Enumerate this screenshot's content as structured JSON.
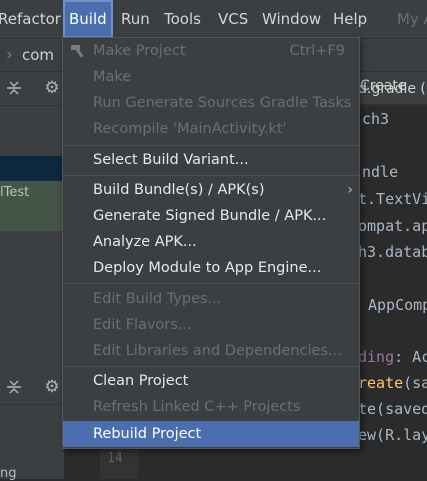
{
  "menubar": {
    "refactor": "Refactor",
    "build": "Build",
    "run": "Run",
    "tools": "Tools",
    "vcs": "VCS",
    "window": "Window",
    "help": "Help",
    "project_title": "My A"
  },
  "breadcrumb": {
    "package": "com"
  },
  "editor_tab": {
    "label": "Create"
  },
  "left_panel": {
    "test_label": "lTest",
    "bottom_text": "ng"
  },
  "code_lines": {
    "l1": "d.gradle (S",
    "l2": "ch3",
    "l3": "ndle",
    "l4": "t.TextVi",
    "l5": "ompat.ap",
    "l6": "h3.datab",
    "l7": "AppComp",
    "l8_colon": ": Ac",
    "l8_word": "ding",
    "l9_call": "reate",
    "l9_arg": "(sa",
    "l10": "te(saved",
    "l11": "ew(R.lay",
    "line_number": "14"
  },
  "build_menu": {
    "make_project": "Make Project",
    "make_project_shortcut": "Ctrl+F9",
    "make": "Make",
    "run_generate_sources": "Run Generate Sources Gradle Tasks",
    "recompile": "Recompile 'MainActivity.kt'",
    "select_build_variant": "Select Build Variant...",
    "build_bundles_apks": "Build Bundle(s) / APK(s)",
    "generate_signed_bundle": "Generate Signed Bundle / APK...",
    "analyze_apk": "Analyze APK...",
    "deploy_module": "Deploy Module to App Engine...",
    "edit_build_types": "Edit Build Types...",
    "edit_flavors": "Edit Flavors...",
    "edit_libraries": "Edit Libraries and Dependencies...",
    "clean_project": "Clean Project",
    "refresh_linked_cpp": "Refresh Linked C++ Projects",
    "rebuild_project": "Rebuild Project"
  },
  "colors": {
    "highlight": "#4b6eaf",
    "menu_bg": "#3c3f41",
    "editor_bg": "#2b2b2b",
    "disabled_text": "#6e6e6e"
  },
  "icons": {
    "hammer": "hammer-icon",
    "submenu": "chevron-right-icon",
    "collapse": "collapse-all-icon",
    "settings": "gear-icon"
  }
}
